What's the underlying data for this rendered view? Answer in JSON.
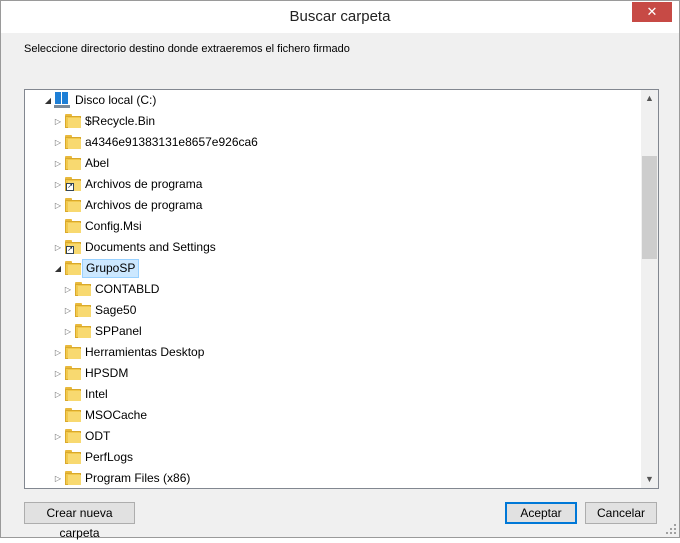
{
  "dialog": {
    "title": "Buscar carpeta",
    "close_glyph": "✕",
    "instruction": "Seleccione directorio destino donde extraeremos el fichero firmado"
  },
  "tree": {
    "root_label": "Disco local (C:)",
    "items": [
      {
        "label": "$Recycle.Bin",
        "level": 1,
        "expander": "collapsed",
        "icon": "folder-icon"
      },
      {
        "label": "a4346e91383131e8657e926ca6",
        "level": 1,
        "expander": "collapsed",
        "icon": "folder-icon"
      },
      {
        "label": "Abel",
        "level": 1,
        "expander": "collapsed",
        "icon": "folder-icon"
      },
      {
        "label": "Archivos de programa",
        "level": 1,
        "expander": "collapsed",
        "icon": "shortcut-folder-icon"
      },
      {
        "label": "Archivos de programa",
        "level": 1,
        "expander": "collapsed",
        "icon": "folder-icon"
      },
      {
        "label": "Config.Msi",
        "level": 1,
        "expander": "none",
        "icon": "folder-icon"
      },
      {
        "label": "Documents and Settings",
        "level": 1,
        "expander": "collapsed",
        "icon": "shortcut-folder-icon"
      },
      {
        "label": "GrupoSP",
        "level": 1,
        "expander": "expanded",
        "icon": "folder-icon",
        "selected": true
      },
      {
        "label": "CONTABLD",
        "level": 2,
        "expander": "collapsed",
        "icon": "folder-icon"
      },
      {
        "label": "Sage50",
        "level": 2,
        "expander": "collapsed",
        "icon": "folder-icon"
      },
      {
        "label": "SPPanel",
        "level": 2,
        "expander": "collapsed",
        "icon": "folder-icon"
      },
      {
        "label": "Herramientas Desktop",
        "level": 1,
        "expander": "collapsed",
        "icon": "folder-icon"
      },
      {
        "label": "HPSDM",
        "level": 1,
        "expander": "collapsed",
        "icon": "folder-icon"
      },
      {
        "label": "Intel",
        "level": 1,
        "expander": "collapsed",
        "icon": "folder-icon"
      },
      {
        "label": "MSOCache",
        "level": 1,
        "expander": "none",
        "icon": "folder-icon"
      },
      {
        "label": "ODT",
        "level": 1,
        "expander": "collapsed",
        "icon": "folder-icon"
      },
      {
        "label": "PerfLogs",
        "level": 1,
        "expander": "none",
        "icon": "folder-icon"
      },
      {
        "label": "Program Files (x86)",
        "level": 1,
        "expander": "collapsed",
        "icon": "folder-icon"
      }
    ]
  },
  "buttons": {
    "new_folder": "Crear nueva carpeta",
    "accept": "Aceptar",
    "cancel": "Cancelar"
  },
  "colors": {
    "close_button": "#c74a45",
    "selection": "#cce8ff",
    "default_button_border": "#0078d7"
  }
}
